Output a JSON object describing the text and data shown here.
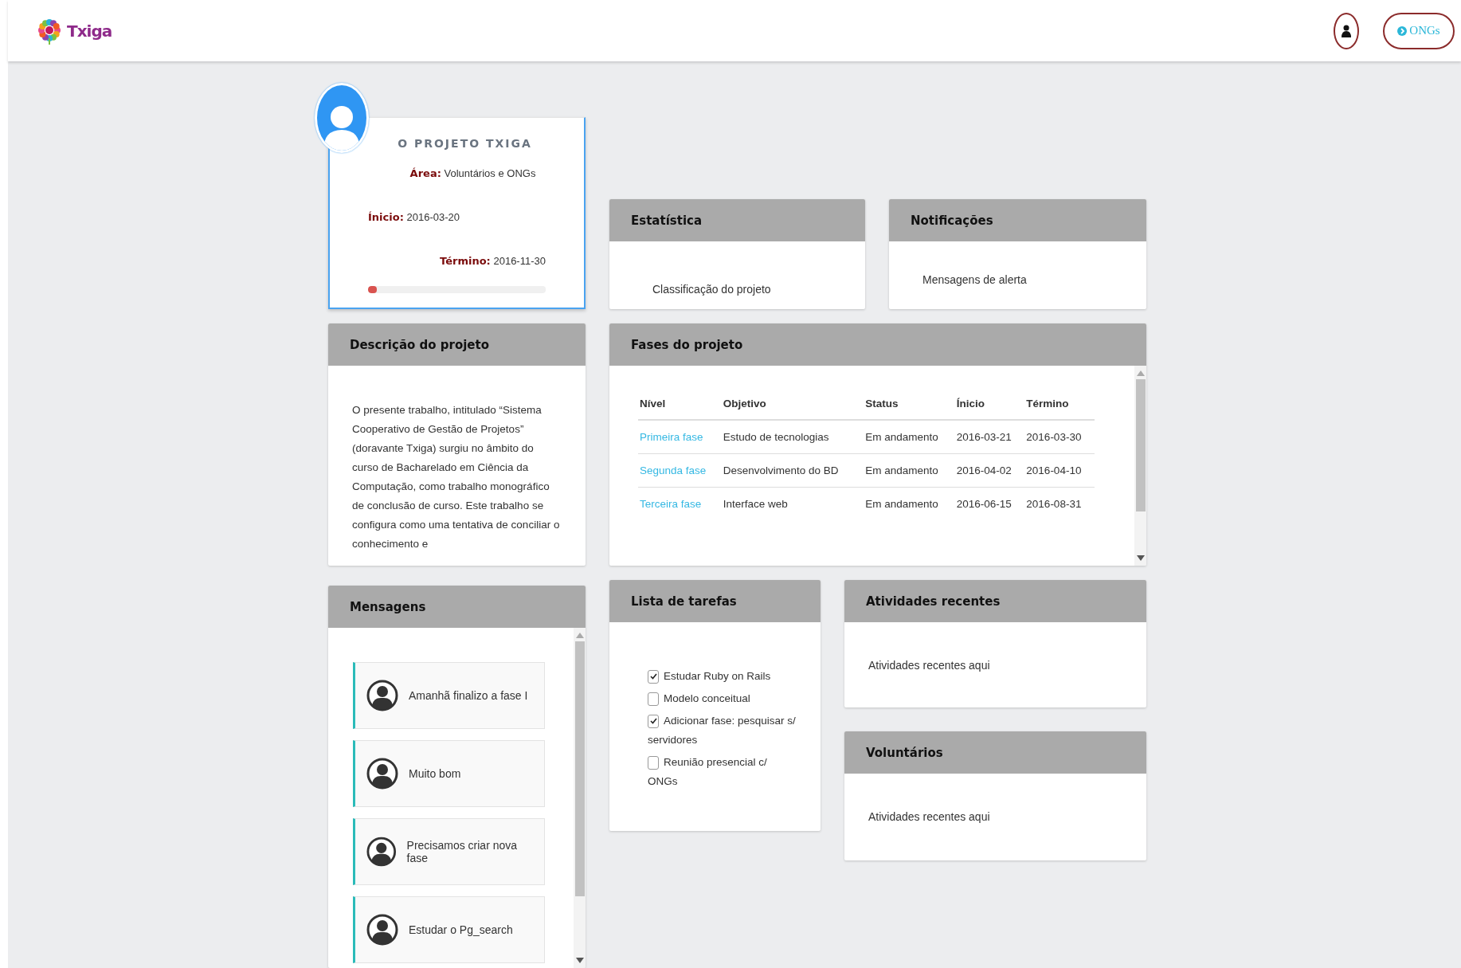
{
  "header": {
    "logo_text": "Txiga",
    "ongs_button": "ONGs"
  },
  "project_card": {
    "title": "O PROJETO TXIGA",
    "fields": [
      {
        "label": "Área:",
        "value": "Voluntários e ONGs"
      },
      {
        "label": "Ínicio:",
        "value": "2016-03-20"
      },
      {
        "label": "Término:",
        "value": "2016-11-30"
      }
    ],
    "progress": {
      "level": 0.05
    }
  },
  "statistics": {
    "title": "Estatística",
    "text": "Classificação do projeto"
  },
  "notifications": {
    "title": "Notificações",
    "text": "Mensagens de alerta"
  },
  "description": {
    "title": "Descrição do projeto",
    "text": "O presente trabalho, intitulado “Sistema Cooperativo de Gestão de Projetos” (doravante Txiga) surgiu no âmbito do curso de Bacharelado em Ciência da Computação, como trabalho monográfico de conclusão de curso. Este trabalho se configura como uma tentativa de conciliar o conhecimento e"
  },
  "phases": {
    "title": "Fases do projeto",
    "columns": [
      "Nível",
      "Objetivo",
      "Status",
      "Ínicio",
      "Término"
    ],
    "rows": [
      {
        "cells": [
          "Primeira fase",
          "Estudo de tecnologias",
          "Em andamento",
          "2016-03-21",
          "2016-03-30"
        ]
      },
      {
        "cells": [
          "Segunda fase",
          "Desenvolvimento do BD",
          "Em andamento",
          "2016-04-02",
          "2016-04-10"
        ]
      },
      {
        "cells": [
          "Terceira fase",
          "Interface web",
          "Em andamento",
          "2016-06-15",
          "2016-08-31"
        ]
      }
    ]
  },
  "messages": {
    "title": "Mensagens",
    "items": [
      "Amanhã finalizo a fase I",
      "Muito bom",
      "Precisamos criar nova fase",
      "Estudar o Pg_search"
    ]
  },
  "tasks": {
    "title": "Lista de tarefas",
    "items": [
      {
        "label": "Estudar Ruby on Rails",
        "checked": true
      },
      {
        "label": "Modelo conceitual",
        "checked": false
      },
      {
        "label": "Adicionar fase: pesquisar s/ servidores",
        "checked": true
      },
      {
        "label": "Reunião presencial c/ ONGs",
        "checked": false
      }
    ]
  },
  "recent_activity": {
    "title": "Atividades recentes",
    "text": "Atividades recentes aqui"
  },
  "volunteers": {
    "title": "Voluntários",
    "text": "Atividades recentes aqui"
  }
}
